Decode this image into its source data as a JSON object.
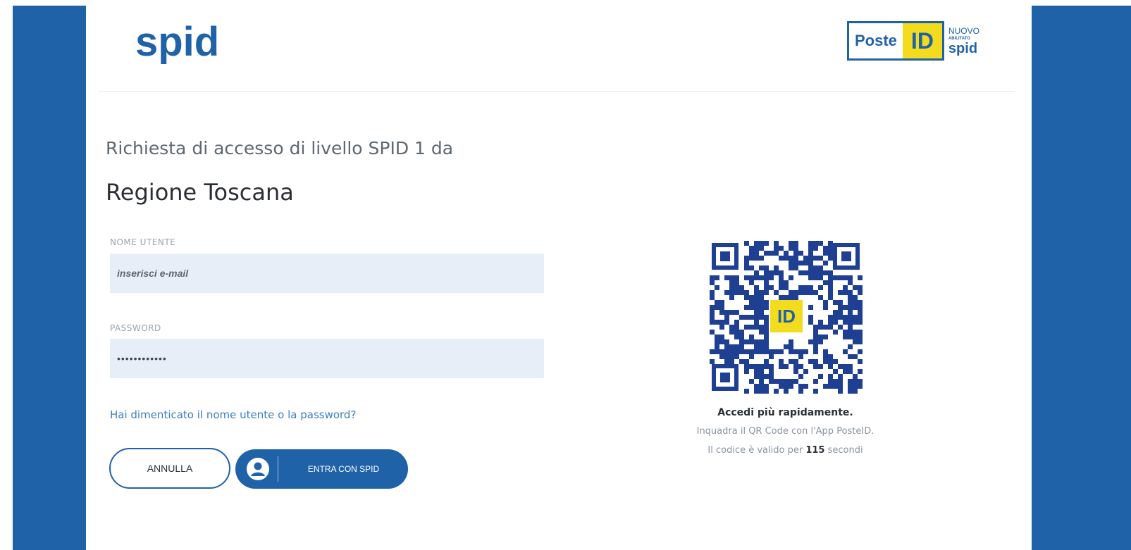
{
  "header": {
    "logo_text": "spid",
    "poste_badge": {
      "word": "Poste",
      "id": "ID",
      "nuovo": "NUOVO",
      "abilitato": "ABILITATO",
      "spid": "spid"
    }
  },
  "main": {
    "request_line": "Richiesta di accesso di livello SPID 1 da",
    "entity_name": "Regione Toscana",
    "username_label": "NOME UTENTE",
    "username_placeholder": "inserisci e-mail",
    "password_label": "PASSWORD",
    "password_value": "••••••••••••",
    "forgot_link": "Hai dimenticato il nome utente o la password?",
    "cancel_label": "ANNULLA",
    "login_label": "ENTRA CON SPID"
  },
  "qr": {
    "center_label": "ID",
    "caption_title": "Accedi più rapidamente.",
    "caption_line2": "Inquadra il QR Code con l'App PosteID.",
    "caption_prefix": "Il codice è valido per",
    "seconds": "115",
    "caption_suffix": "secondi"
  },
  "colors": {
    "brand_blue": "#1f62a8",
    "field_bg": "#e8eef8",
    "yellow": "#f3dc1e",
    "link": "#3e7dc3"
  }
}
